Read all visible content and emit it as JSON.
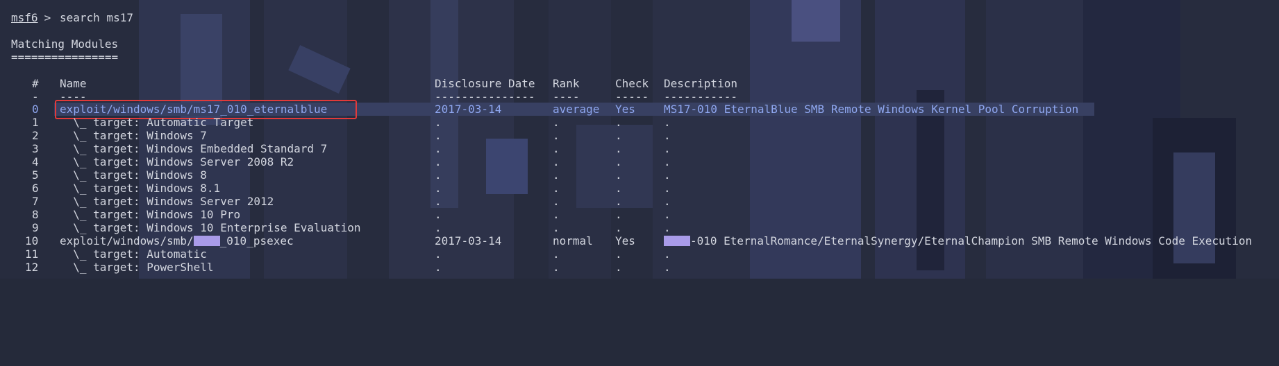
{
  "prompt": {
    "user": "msf6",
    "symbol": " > ",
    "command": "search ms17"
  },
  "section_title": "Matching Modules",
  "section_rule": "================",
  "headers": {
    "num": "#",
    "name": "Name",
    "date": "Disclosure Date",
    "rank": "Rank",
    "check": "Check",
    "desc": "Description"
  },
  "header_rules": {
    "num": "-",
    "name": "----",
    "date": "---------------",
    "rank": "----",
    "check": "-----",
    "desc": "-----------"
  },
  "highlight_color": "#e23a3a",
  "rows": [
    {
      "num": "0",
      "name": "exploit/windows/smb/ms17_010_eternalblue",
      "date": "2017-03-14",
      "rank": "average",
      "check": "Yes",
      "desc": "MS17-010 EternalBlue SMB Remote Windows Kernel Pool Corruption"
    },
    {
      "num": "1",
      "name": "  \\_ target: Automatic Target",
      "date": ".",
      "rank": ".",
      "check": ".",
      "desc": "."
    },
    {
      "num": "2",
      "name": "  \\_ target: Windows 7",
      "date": ".",
      "rank": ".",
      "check": ".",
      "desc": "."
    },
    {
      "num": "3",
      "name": "  \\_ target: Windows Embedded Standard 7",
      "date": ".",
      "rank": ".",
      "check": ".",
      "desc": "."
    },
    {
      "num": "4",
      "name": "  \\_ target: Windows Server 2008 R2",
      "date": ".",
      "rank": ".",
      "check": ".",
      "desc": "."
    },
    {
      "num": "5",
      "name": "  \\_ target: Windows 8",
      "date": ".",
      "rank": ".",
      "check": ".",
      "desc": "."
    },
    {
      "num": "6",
      "name": "  \\_ target: Windows 8.1",
      "date": ".",
      "rank": ".",
      "check": ".",
      "desc": "."
    },
    {
      "num": "7",
      "name": "  \\_ target: Windows Server 2012",
      "date": ".",
      "rank": ".",
      "check": ".",
      "desc": "."
    },
    {
      "num": "8",
      "name": "  \\_ target: Windows 10 Pro",
      "date": ".",
      "rank": ".",
      "check": ".",
      "desc": "."
    },
    {
      "num": "9",
      "name": "  \\_ target: Windows 10 Enterprise Evaluation",
      "date": ".",
      "rank": ".",
      "check": ".",
      "desc": "."
    },
    {
      "num": "10",
      "name_prefix": "exploit/windows/smb/",
      "name_suffix": "_010_psexec",
      "date": "2017-03-14",
      "rank": "normal",
      "check": "Yes",
      "desc_suffix": "-010 EternalRomance/EternalSynergy/EternalChampion SMB Remote Windows Code Execution"
    },
    {
      "num": "11",
      "name": "  \\_ target: Automatic",
      "date": ".",
      "rank": ".",
      "check": ".",
      "desc": "."
    },
    {
      "num": "12",
      "name": "  \\_ target: PowerShell",
      "date": ".",
      "rank": ".",
      "check": ".",
      "desc": "."
    }
  ]
}
